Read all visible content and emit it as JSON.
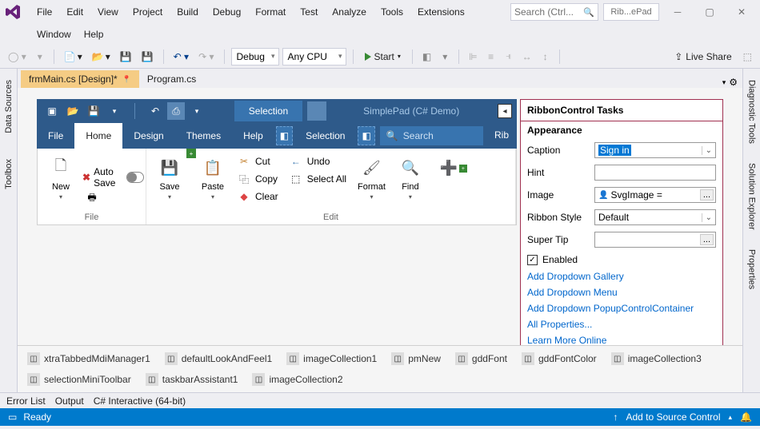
{
  "menu": [
    "File",
    "Edit",
    "View",
    "Project",
    "Build",
    "Debug",
    "Format",
    "Test",
    "Analyze",
    "Tools",
    "Extensions",
    "Window",
    "Help"
  ],
  "search_placeholder": "Search (Ctrl...",
  "solution_name": "Rib...ePad",
  "toolbar": {
    "config": "Debug",
    "platform": "Any CPU",
    "start": "Start",
    "liveshare": "Live Share"
  },
  "rails": {
    "left": [
      "Data Sources",
      "Toolbox"
    ],
    "right": [
      "Diagnostic Tools",
      "Solution Explorer",
      "Properties"
    ]
  },
  "tabs": [
    {
      "label": "frmMain.cs [Design]*",
      "active": true,
      "pinned": true
    },
    {
      "label": "Program.cs",
      "active": false
    }
  ],
  "ribbon": {
    "title_tab": "Selection",
    "app_name": "SimplePad (C# Demo)",
    "tabs": [
      "File",
      "Home",
      "Design",
      "Themes",
      "Help"
    ],
    "active_tab": "Home",
    "sel_label": "Selection",
    "search_placeholder": "Search",
    "rib_label": "Rib",
    "groups": {
      "file": {
        "title": "File",
        "new": "New",
        "autosave": "Auto Save"
      },
      "edit": {
        "title": "Edit",
        "save": "Save",
        "paste": "Paste",
        "cut": "Cut",
        "copy": "Copy",
        "clear": "Clear",
        "undo": "Undo",
        "selectall": "Select All",
        "format": "Format",
        "find": "Find"
      }
    }
  },
  "tasks": {
    "title": "RibbonControl Tasks",
    "section": "Appearance",
    "caption": {
      "label": "Caption",
      "value": "Sign in"
    },
    "hint": {
      "label": "Hint",
      "value": ""
    },
    "image": {
      "label": "Image",
      "value": "SvgImage ="
    },
    "style": {
      "label": "Ribbon Style",
      "value": "Default"
    },
    "supertip": {
      "label": "Super Tip",
      "value": ""
    },
    "enabled": "Enabled",
    "links": [
      "Add Dropdown Gallery",
      "Add Dropdown Menu",
      "Add Dropdown PopupControlContainer",
      "All Properties...",
      "Learn More Online"
    ]
  },
  "components": [
    "xtraTabbedMdiManager1",
    "defaultLookAndFeel1",
    "imageCollection1",
    "pmNew",
    "gddFont",
    "gddFontColor",
    "imageCollection3",
    "selectionMiniToolbar",
    "taskbarAssistant1",
    "imageCollection2"
  ],
  "bottom_tabs": [
    "Error List",
    "Output",
    "C# Interactive (64-bit)"
  ],
  "status": {
    "text": "Ready",
    "source": "Add to Source Control"
  }
}
